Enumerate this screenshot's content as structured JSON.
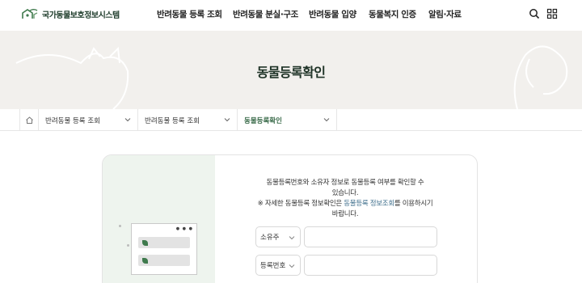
{
  "header": {
    "logo_text": "국가동물보호정보시스템",
    "nav": [
      "반려동물 등록 조회",
      "반려동물 분실·구조",
      "반려동물 입양",
      "동물복지 인증",
      "알림·자료"
    ],
    "icons": [
      "search-icon",
      "grid-menu-icon"
    ]
  },
  "banner": {
    "title": "동물등록확인"
  },
  "breadcrumb": {
    "home_icon": "home-icon",
    "items": [
      "반려동물 등록 조회",
      "반려동물 등록 조회",
      "동물등록확인"
    ]
  },
  "form": {
    "desc_line1": "동물등록번호와 소유자 정보로 동물등록 여부를 확인할 수",
    "desc_line2": "있습니다.",
    "desc_line3_pre": "※ 자세한 동물등록 정보확인은 ",
    "desc_line3_link": "동물등록 정보조회",
    "desc_line3_post": "를 이용하시기",
    "desc_line4": "바랍니다.",
    "row1_select": "소유주",
    "row2_select": "등록번호",
    "row1_value": "",
    "row2_value": ""
  },
  "colors": {
    "accent_green": "#3a6b4a",
    "banner_bg": "#f2f0ed",
    "card_left_bg": "#eef4ee",
    "link_blue": "#3f6f8c"
  }
}
